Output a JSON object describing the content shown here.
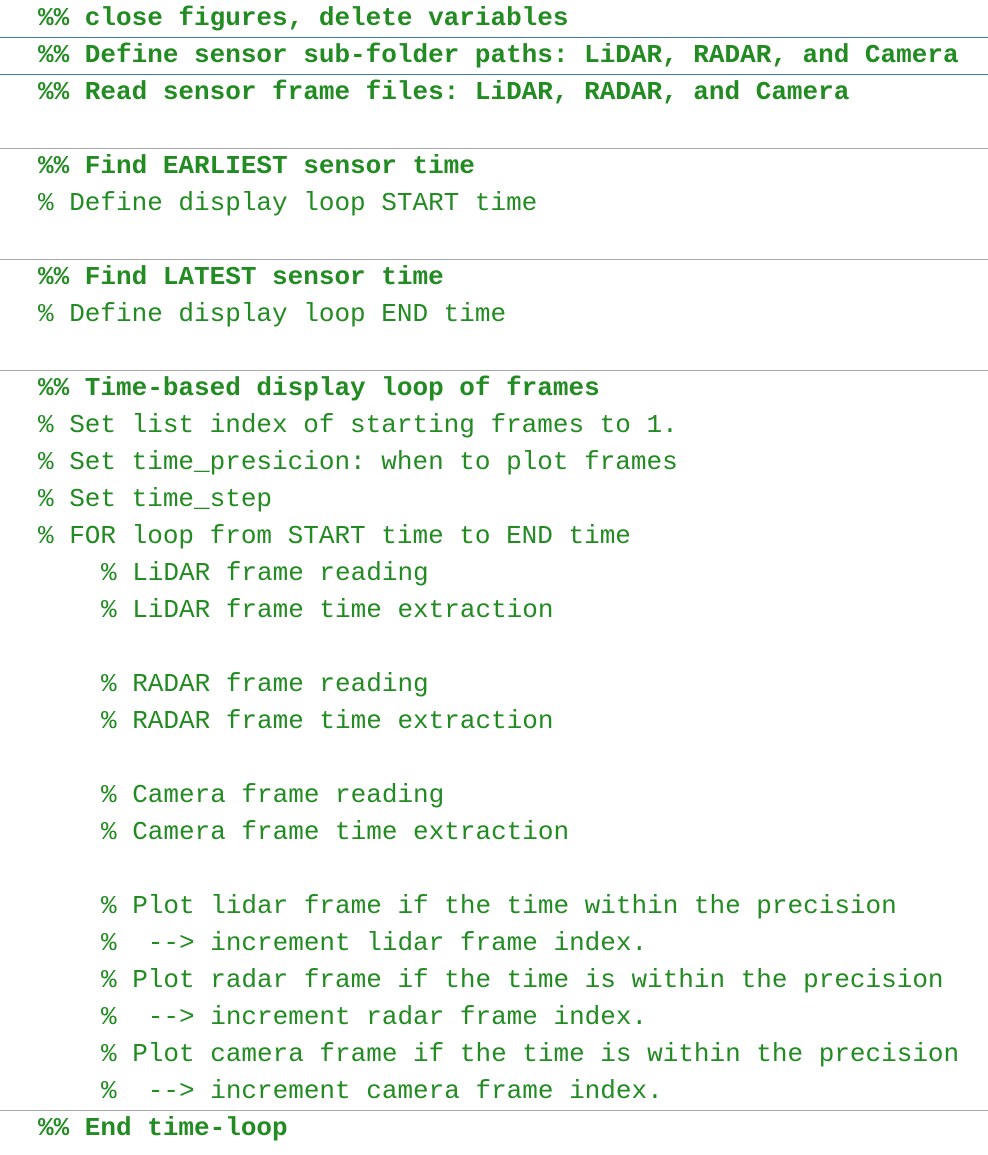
{
  "colors": {
    "comment": "#228b22",
    "divider": "#a8a8a8",
    "active_divider": "#3a7ca5",
    "background": "#ffffff"
  },
  "lines": [
    "%% close figures, delete variables",
    "%% Define sensor sub-folder paths: LiDAR, RADAR, and Camera",
    "%% Read sensor frame files: LiDAR, RADAR, and Camera",
    "",
    "%% Find EARLIEST sensor time",
    "% Define display loop START time",
    "",
    "%% Find LATEST sensor time",
    "% Define display loop END time",
    "",
    "%% Time-based display loop of frames",
    "% Set list index of starting frames to 1.",
    "% Set time_presicion: when to plot frames",
    "% Set time_step",
    "% FOR loop from START time to END time",
    "% LiDAR frame reading",
    "% LiDAR frame time extraction",
    "",
    "% RADAR frame reading",
    "% RADAR frame time extraction",
    "",
    "% Camera frame reading",
    "% Camera frame time extraction",
    "",
    "% Plot lidar frame if the time within the precision",
    "%  --> increment lidar frame index.",
    "% Plot radar frame if the time is within the precision",
    "%  --> increment radar frame index.",
    "% Plot camera frame if the time is within the precision",
    "%  --> increment camera frame index.",
    "%% End time-loop"
  ]
}
